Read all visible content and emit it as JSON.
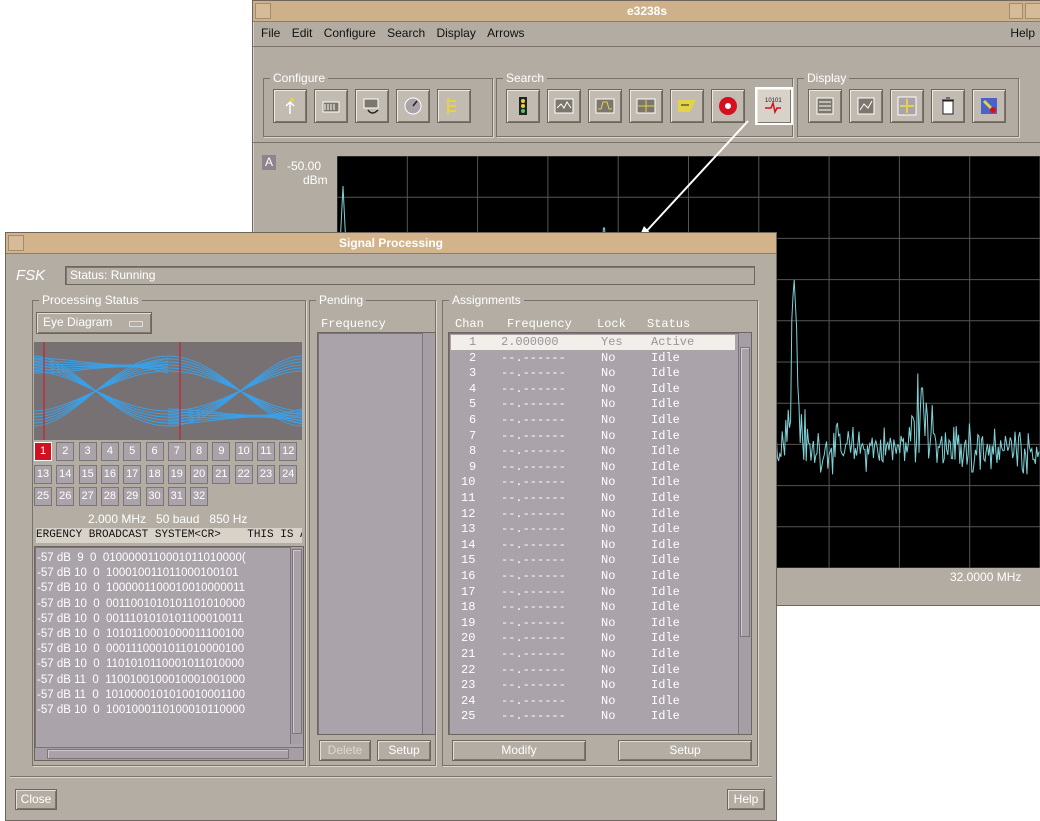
{
  "main": {
    "title": "e3238s",
    "menu": [
      "File",
      "Edit",
      "Configure",
      "Search",
      "Display",
      "Arrows"
    ],
    "help": "Help",
    "groups": {
      "configure": "Configure",
      "search": "Search",
      "display": "Display"
    },
    "toolbar_icons": {
      "configure": [
        "antenna-icon",
        "receiver-icon",
        "tuner-icon",
        "dial-icon",
        "tree-icon"
      ],
      "search": [
        "traffic-light-icon",
        "spectrum-icon",
        "band-icon",
        "threshold-icon",
        "filter-icon",
        "record-icon",
        "signal-processing-icon"
      ],
      "display": [
        "list-icon",
        "graph-icon",
        "arrows-icon",
        "trash-icon",
        "marker-icon"
      ]
    },
    "trace_label": "A",
    "ref_level": "-50.00",
    "ref_unit": "dBm",
    "freq_stop": "32.0000 MHz",
    "colors": {
      "trace": "#7fd3d8",
      "grid": "#555555"
    }
  },
  "dialog": {
    "title": "Signal Processing",
    "mode": "FSK",
    "status": "Status: Running",
    "processing_status": "Processing Status",
    "view": "Eye Diagram",
    "channels": [
      "1",
      "2",
      "3",
      "4",
      "5",
      "6",
      "7",
      "8",
      "9",
      "10",
      "11",
      "12",
      "13",
      "14",
      "15",
      "16",
      "17",
      "18",
      "19",
      "20",
      "21",
      "22",
      "23",
      "24",
      "25",
      "26",
      "27",
      "28",
      "29",
      "30",
      "31",
      "32"
    ],
    "selected_channel": "1",
    "params": "2.000 MHz   50 baud   850 Hz",
    "decoded": "ERGENCY BROADCAST SYSTEM<CR>    THIS IS A",
    "bits": [
      "-57 dB  9  0  0100000110001011010000(",
      "-57 dB 10  0  100010011011000100101",
      "-57 dB 10  0  1000001100010010000011",
      "-57 dB 10  0  0011001010101101010000",
      "-57 dB 10  0  0011101010101100010011",
      "-57 dB 10  0  1010110001000011100100",
      "-57 dB 10  0  0001110001011010000100",
      "-57 dB 10  0  1101010110001011010000",
      "-57 dB 11  0  1100100100010001001000",
      "-57 dB 11  0  1010000101010010001100",
      "-57 dB 10  0  1001000110100010110000"
    ],
    "pending": {
      "label": "Pending",
      "column": "Frequency",
      "delete": "Delete",
      "setup": "Setup"
    },
    "assignments": {
      "label": "Assignments",
      "columns": [
        "Chan",
        "Frequency",
        "Lock",
        "Status"
      ],
      "rows": [
        [
          "1",
          "2.000000",
          "Yes",
          "Active"
        ],
        [
          "2",
          "--.------",
          "No",
          "Idle"
        ],
        [
          "3",
          "--.------",
          "No",
          "Idle"
        ],
        [
          "4",
          "--.------",
          "No",
          "Idle"
        ],
        [
          "5",
          "--.------",
          "No",
          "Idle"
        ],
        [
          "6",
          "--.------",
          "No",
          "Idle"
        ],
        [
          "7",
          "--.------",
          "No",
          "Idle"
        ],
        [
          "8",
          "--.------",
          "No",
          "Idle"
        ],
        [
          "9",
          "--.------",
          "No",
          "Idle"
        ],
        [
          "10",
          "--.------",
          "No",
          "Idle"
        ],
        [
          "11",
          "--.------",
          "No",
          "Idle"
        ],
        [
          "12",
          "--.------",
          "No",
          "Idle"
        ],
        [
          "13",
          "--.------",
          "No",
          "Idle"
        ],
        [
          "14",
          "--.------",
          "No",
          "Idle"
        ],
        [
          "15",
          "--.------",
          "No",
          "Idle"
        ],
        [
          "16",
          "--.------",
          "No",
          "Idle"
        ],
        [
          "17",
          "--.------",
          "No",
          "Idle"
        ],
        [
          "18",
          "--.------",
          "No",
          "Idle"
        ],
        [
          "19",
          "--.------",
          "No",
          "Idle"
        ],
        [
          "20",
          "--.------",
          "No",
          "Idle"
        ],
        [
          "21",
          "--.------",
          "No",
          "Idle"
        ],
        [
          "22",
          "--.------",
          "No",
          "Idle"
        ],
        [
          "23",
          "--.------",
          "No",
          "Idle"
        ],
        [
          "24",
          "--.------",
          "No",
          "Idle"
        ],
        [
          "25",
          "--.------",
          "No",
          "Idle"
        ]
      ],
      "modify": "Modify",
      "setup": "Setup"
    },
    "close": "Close",
    "help": "Help"
  }
}
